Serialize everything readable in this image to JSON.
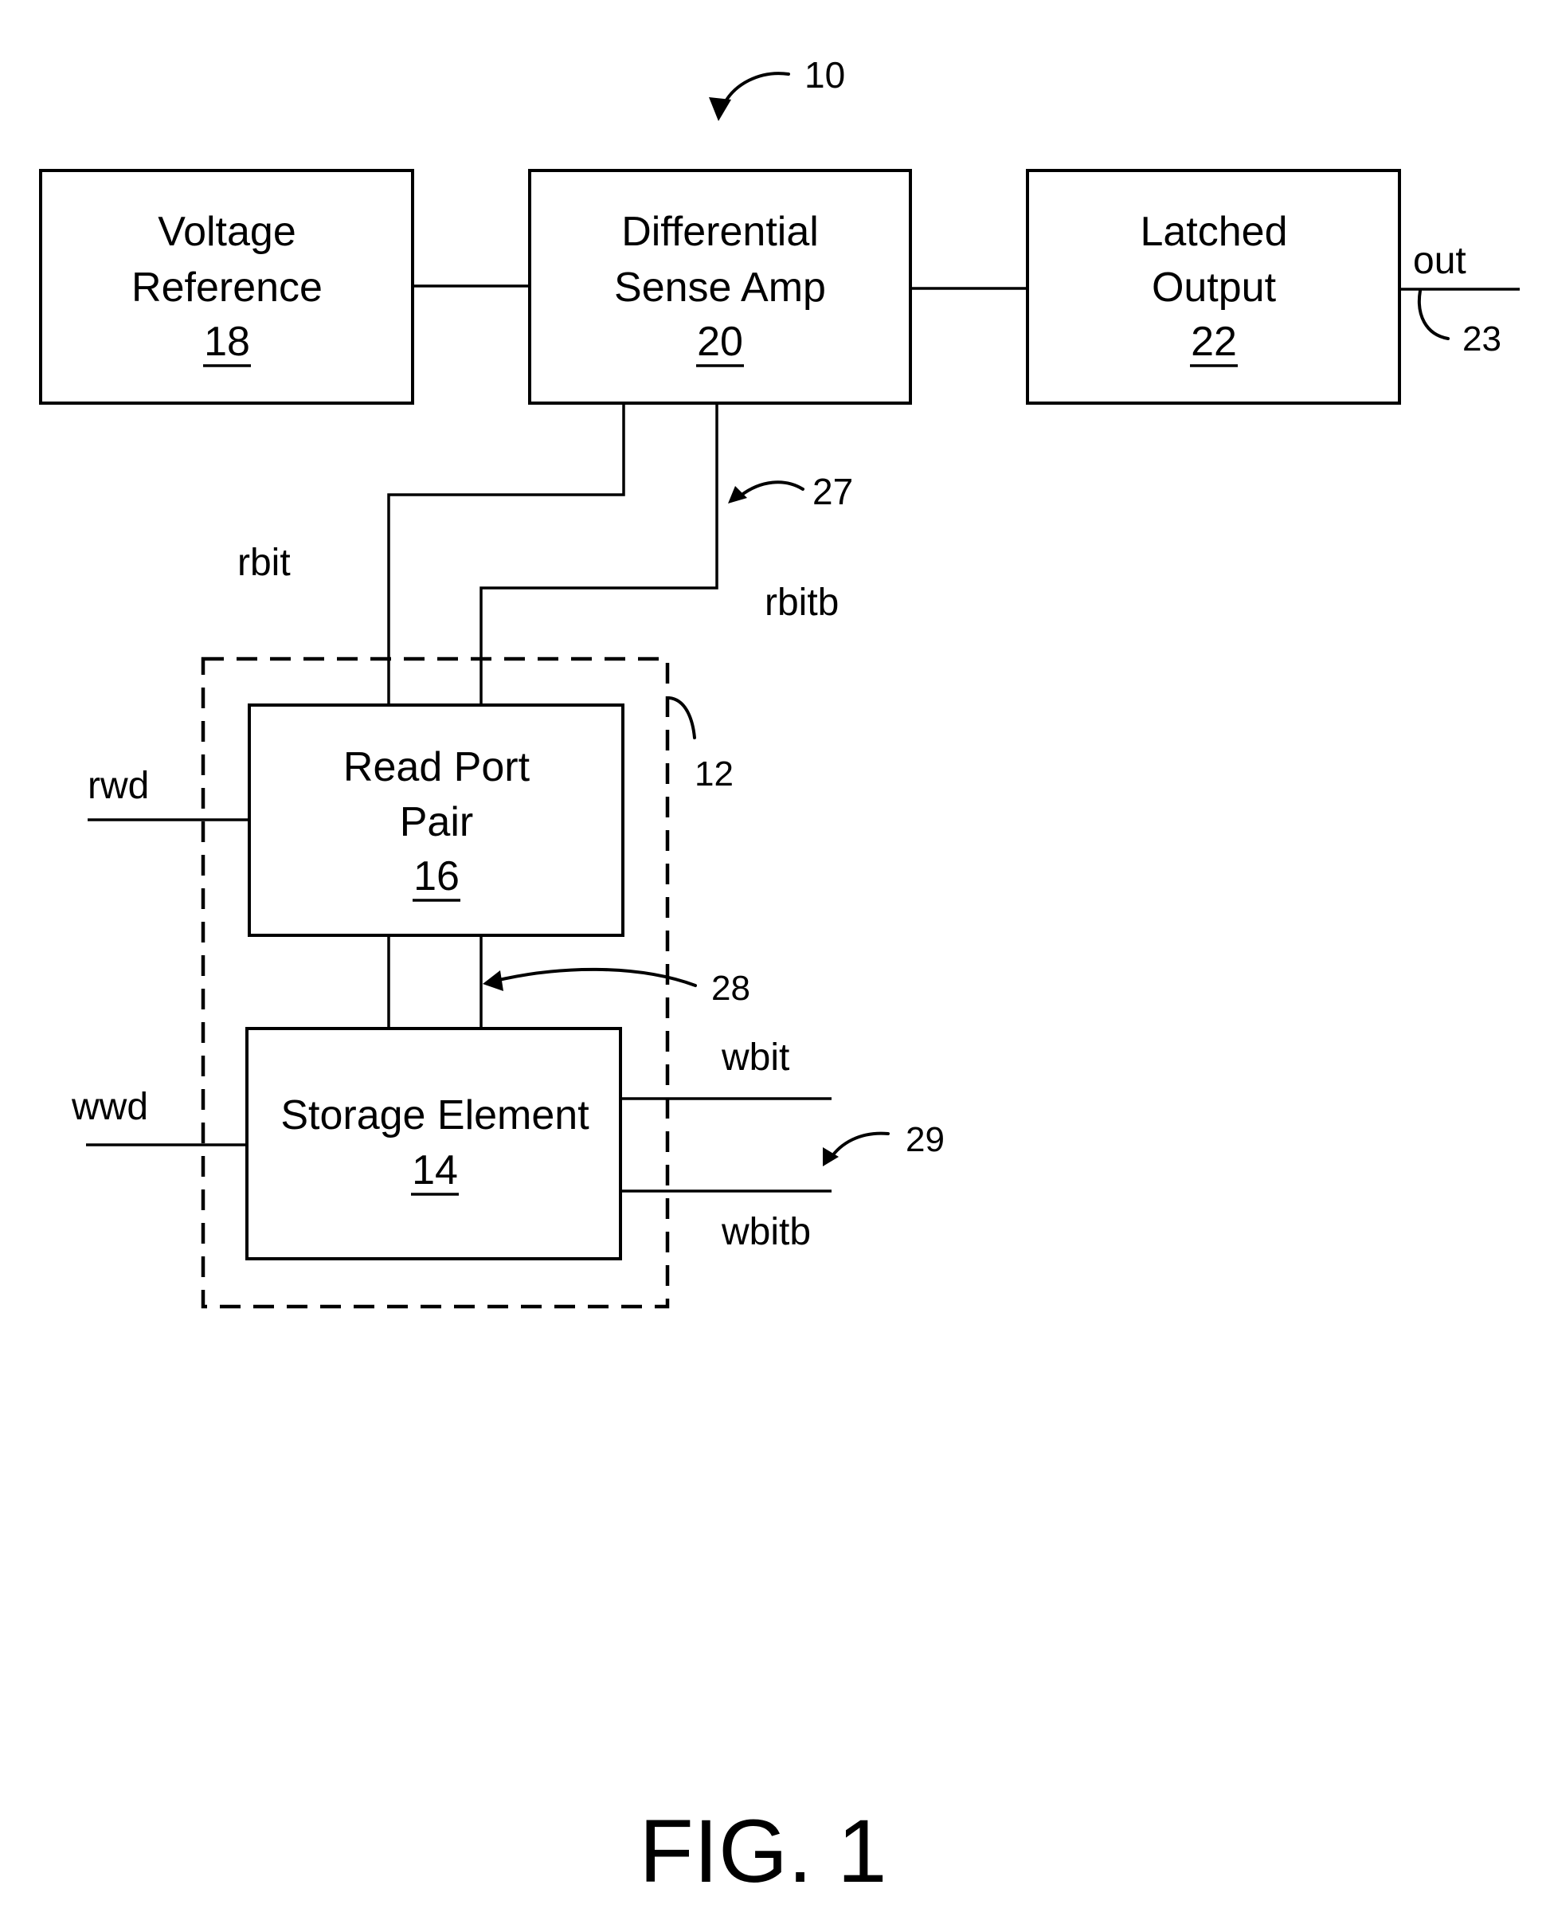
{
  "figure": {
    "ref": "10",
    "caption": "FIG. 1"
  },
  "blocks": {
    "voltage_reference": {
      "line1": "Voltage",
      "line2": "Reference",
      "ref": "18"
    },
    "sense_amp": {
      "line1": "Differential",
      "line2": "Sense Amp",
      "ref": "20"
    },
    "latched_output": {
      "line1": "Latched",
      "line2": "Output",
      "ref": "22"
    },
    "read_port": {
      "line1": "Read Port",
      "line2": "Pair",
      "ref": "16"
    },
    "storage": {
      "line1": "Storage Element",
      "ref": "14"
    }
  },
  "cell_group": {
    "ref": "12"
  },
  "signals": {
    "out": "out",
    "out_ref": "23",
    "rbit": "rbit",
    "rbitb": "rbitb",
    "read_bus_ref": "27",
    "internal_ref": "28",
    "rwd": "rwd",
    "wwd": "wwd",
    "wbit": "wbit",
    "wbitb": "wbitb",
    "write_bus_ref": "29"
  }
}
